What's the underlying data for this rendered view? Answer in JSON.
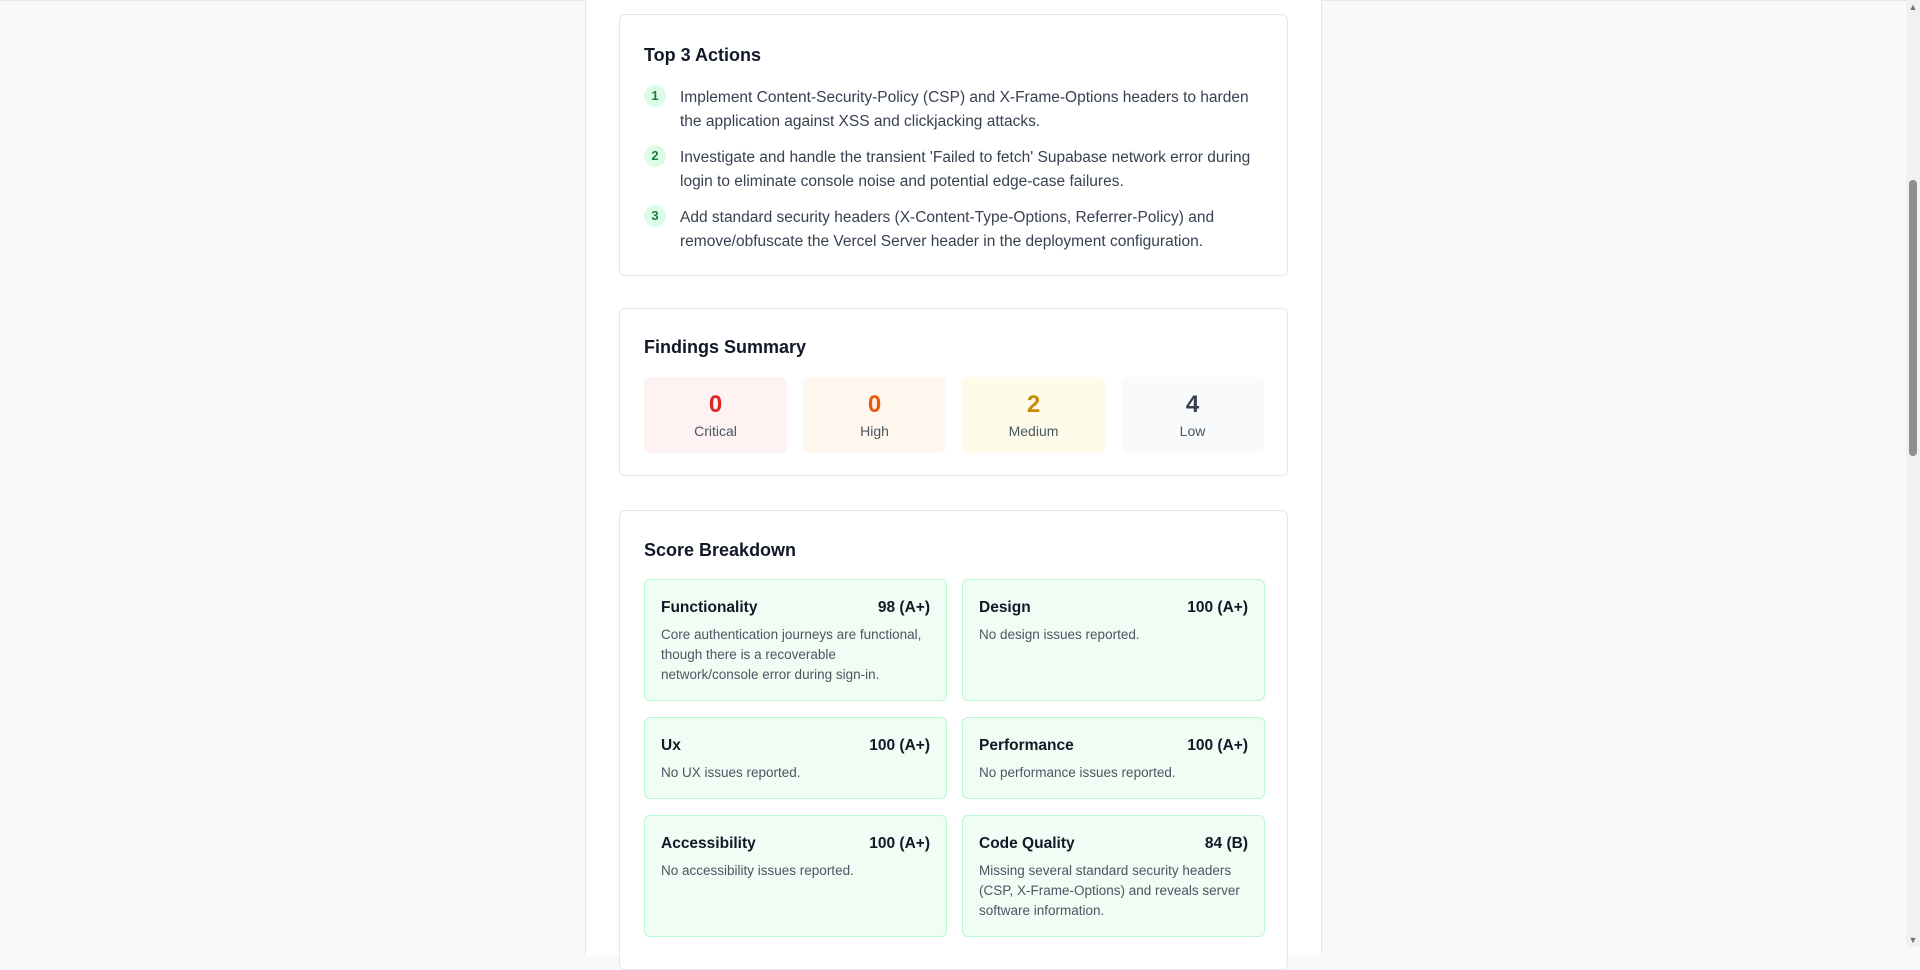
{
  "top_actions": {
    "title": "Top 3 Actions",
    "items": [
      {
        "num": "1",
        "text": "Implement Content-Security-Policy (CSP) and X-Frame-Options headers to harden the application against XSS and clickjacking attacks."
      },
      {
        "num": "2",
        "text": "Investigate and handle the transient 'Failed to fetch' Supabase network error during login to eliminate console noise and potential edge-case failures."
      },
      {
        "num": "3",
        "text": "Add standard security headers (X-Content-Type-Options, Referrer-Policy) and remove/obfuscate the Vercel Server header in the deployment configuration."
      }
    ]
  },
  "findings": {
    "title": "Findings Summary",
    "items": [
      {
        "count": "0",
        "label": "Critical",
        "color": "#dc2626",
        "bg": "#fef2f2"
      },
      {
        "count": "0",
        "label": "High",
        "color": "#ea580c",
        "bg": "#fff7ed"
      },
      {
        "count": "2",
        "label": "Medium",
        "color": "#ca8a04",
        "bg": "#fefce8"
      },
      {
        "count": "4",
        "label": "Low",
        "color": "#374151",
        "bg": "#f9fafb"
      }
    ]
  },
  "scores": {
    "title": "Score Breakdown",
    "items": [
      {
        "name": "Functionality",
        "value": "98 (A+)",
        "desc": "Core authentication journeys are functional, though there is a recoverable network/console error during sign-in."
      },
      {
        "name": "Design",
        "value": "100 (A+)",
        "desc": "No design issues reported."
      },
      {
        "name": "Ux",
        "value": "100 (A+)",
        "desc": "No UX issues reported."
      },
      {
        "name": "Performance",
        "value": "100 (A+)",
        "desc": "No performance issues reported."
      },
      {
        "name": "Accessibility",
        "value": "100 (A+)",
        "desc": "No accessibility issues reported."
      },
      {
        "name": "Code Quality",
        "value": "84 (B)",
        "desc": "Missing several standard security headers (CSP, X-Frame-Options) and reveals server software information."
      }
    ]
  },
  "icons": {
    "scroll_up": "chevron-up-icon",
    "scroll_down": "chevron-down-icon"
  }
}
